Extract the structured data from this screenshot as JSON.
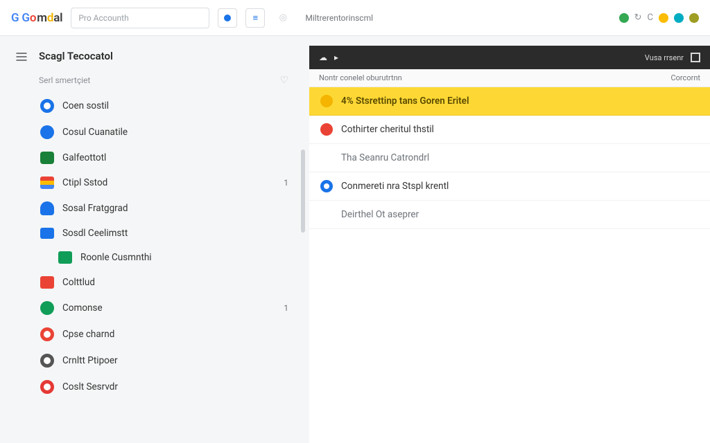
{
  "header": {
    "logo_text": "Gomdal",
    "search_placeholder": "Pro Accounth",
    "secondary_label": "Miltrerentorinscml"
  },
  "sidebar": {
    "title": "Scagl Tecocatol",
    "subheader": "Serl smertçiet",
    "items": [
      {
        "label": "Coen sostil"
      },
      {
        "label": "Cosul Cuanatile"
      },
      {
        "label": "Galfeottotl"
      },
      {
        "label": "Ctipl Sstod",
        "count": "1"
      },
      {
        "label": "Sosal Fratggrad"
      },
      {
        "label": "Sosdl Ceelimstt"
      },
      {
        "label": "Roonle Cusmnthi"
      },
      {
        "label": "Colttlud"
      },
      {
        "label": "Comonse",
        "count": "1"
      },
      {
        "label": "Cpse charnd"
      },
      {
        "label": "Crnltt Ptipoer"
      },
      {
        "label": "Coslt Sesrvdr"
      }
    ]
  },
  "content": {
    "darkbar_right": "Vusa rrsenr",
    "crumb_left": "Nontr conelel oburutrtnn",
    "crumb_right": "Corcornt",
    "rows": [
      {
        "label": "4% Stsrettinp tans Goren Eritel"
      },
      {
        "label": "Cothirter cheritul thstil"
      },
      {
        "label": "Tha Seanru Catrondrl"
      },
      {
        "label": "Conmereti nra Stspl krentl"
      },
      {
        "label": "Deirthel Ot aseprer"
      }
    ]
  }
}
